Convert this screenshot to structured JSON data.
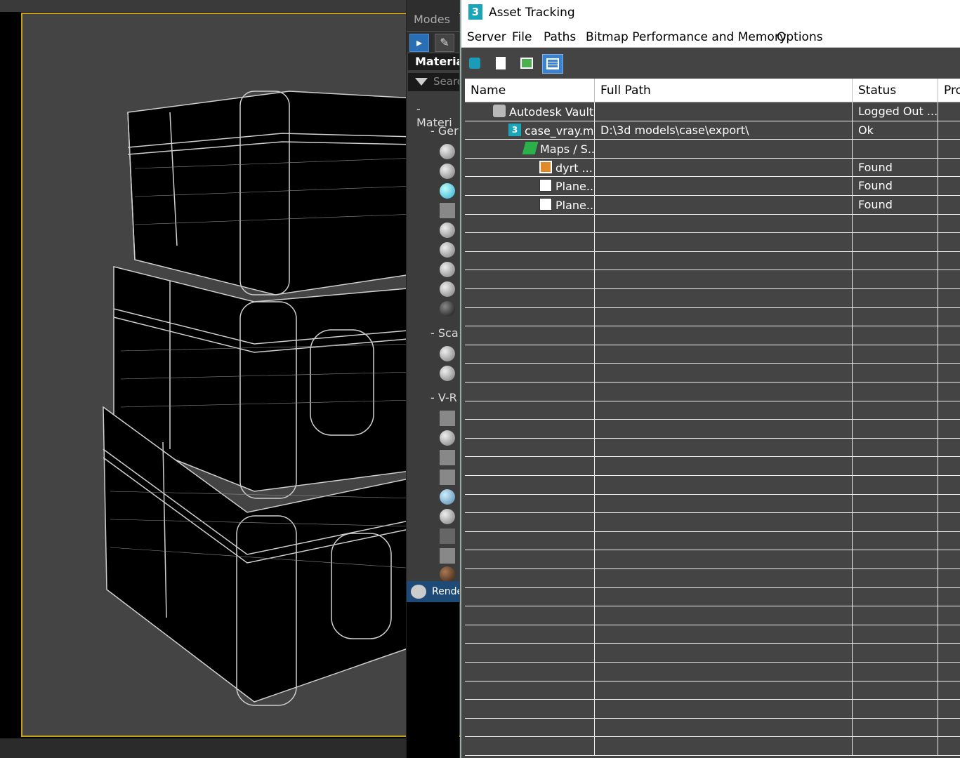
{
  "material_browser": {
    "modes_label": "Modes",
    "title": "Materia",
    "search_placeholder": "Searc",
    "groups": [
      {
        "label": "- Materi"
      },
      {
        "label": "- Ger"
      },
      {
        "label": "- Sca"
      },
      {
        "label": "- V-R"
      }
    ],
    "render_label": "Rende"
  },
  "asset_tracking": {
    "window_title": "Asset Tracking",
    "app_icon_label": "3",
    "menu": [
      "Server",
      "File",
      "Paths",
      "Bitmap Performance and Memory",
      "Options"
    ],
    "columns": [
      "Name",
      "Full Path",
      "Status",
      "Pro"
    ],
    "rows": [
      {
        "name": "Autodesk Vault",
        "path": "",
        "status": "Logged Out ...",
        "icon": "vault-icon"
      },
      {
        "name": "case_vray.m...",
        "path": "D:\\3d models\\case\\export\\",
        "status": "Ok",
        "icon": "max-file-icon"
      },
      {
        "name": "Maps / S...",
        "path": "",
        "status": "",
        "icon": "maps-folder-icon"
      },
      {
        "name": "dyrt ...",
        "path": "",
        "status": "Found",
        "icon": "bitmap-icon"
      },
      {
        "name": "Plane...",
        "path": "",
        "status": "Found",
        "icon": "file-icon"
      },
      {
        "name": "Plane...",
        "path": "",
        "status": "Found",
        "icon": "file-icon"
      }
    ]
  }
}
